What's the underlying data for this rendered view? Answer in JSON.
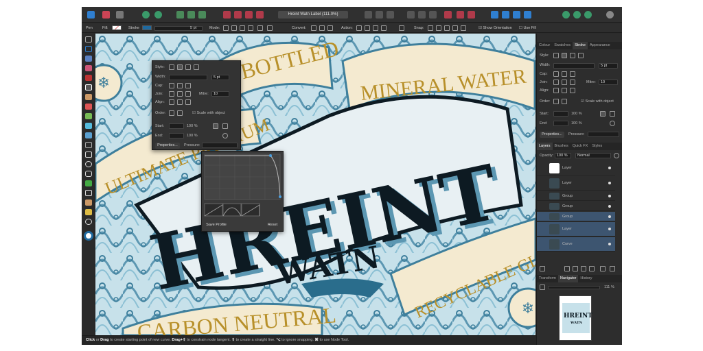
{
  "app": {
    "document_title": "Hreint Watn Label (111.0%)"
  },
  "context_toolbar": {
    "tool_name": "Pen",
    "fill_label": "Fill:",
    "stroke_label": "Stroke",
    "stroke_width": "5 pt",
    "mode_label": "Mode:",
    "convert_label": "Convert:",
    "action_label": "Action:",
    "snap_label": "Snap:",
    "show_orientation_label": "Show Orientation",
    "use_fill_label": "Use Fill",
    "stroke_color": "#1f6aa0"
  },
  "stroke_popover": {
    "style_label": "Style:",
    "width_label": "Width:",
    "width_value": "5 pt",
    "cap_label": "Cap:",
    "join_label": "Join:",
    "mitre_label": "Mitre:",
    "mitre_value": "10",
    "align_label": "Align:",
    "order_label": "Order:",
    "scale_label": "Scale with object",
    "start_label": "Start:",
    "end_label": "End:",
    "start_pct": "100 %",
    "end_pct": "100 %",
    "properties_label": "Properties...",
    "pressure_label": "Pressure:"
  },
  "pressure_curve": {
    "save_profile_label": "Save Profile",
    "reset_label": "Reset"
  },
  "right_panel": {
    "top_tabs": [
      "Colour",
      "Swatches",
      "Stroke",
      "Appearance"
    ],
    "active_top_tab": "Stroke",
    "style_label": "Style:",
    "width_label": "Width:",
    "width_value": "5 pt",
    "cap_label": "Cap:",
    "join_label": "Join:",
    "mitre_label": "Mitre:",
    "mitre_value": "10",
    "align_label": "Align:",
    "order_label": "Order:",
    "scale_label": "Scale with object",
    "start_label": "Start:",
    "end_label": "End:",
    "start_pct": "100 %",
    "end_pct": "100 %",
    "properties_label": "Properties...",
    "pressure_label": "Pressure:",
    "layer_tabs": [
      "Layers",
      "Brushes",
      "Quick FX",
      "Styles"
    ],
    "active_layer_tab": "Layers",
    "opacity_label": "Opacity:",
    "opacity_value": "100 %",
    "blend_mode": "Normal",
    "layers": [
      {
        "name": "Layer",
        "selected": false
      },
      {
        "name": "Layer",
        "selected": false
      },
      {
        "name": "Group",
        "selected": false
      },
      {
        "name": "Group",
        "selected": false
      },
      {
        "name": "Group",
        "selected": true
      },
      {
        "name": "Layer",
        "selected": true
      },
      {
        "name": "Curve",
        "selected": true
      }
    ],
    "nav_tabs": [
      "Transform",
      "Navigator",
      "History"
    ],
    "active_nav_tab": "Navigator",
    "zoom_value": "111 %"
  },
  "artwork": {
    "brand": "HREINT",
    "sub": "WATN",
    "banner_top_left": "BOTTLED",
    "banner_top_right": "MINERAL WATER",
    "banner_left": "ULTIMATE PREMIUM",
    "banner_right": "RECYCLABLE GLASS",
    "banner_bottom_left": "CARBON NEUTRAL",
    "nav_brand": "HREINT",
    "nav_sub": "WATN",
    "ink_color": "#0d1a22",
    "gold_color": "#b8902a",
    "blue_color": "#7fb2c9"
  },
  "status_bar": {
    "segments": [
      {
        "bold": "Click",
        "text": " or "
      },
      {
        "bold": "Drag",
        "text": " to create starting point of new curve. "
      },
      {
        "bold": "Drag+⇧",
        "text": " to constrain node tangent. "
      },
      {
        "bold": "⇧",
        "text": " to create a straight line. "
      },
      {
        "bold": "⌥",
        "text": " to ignore snapping. "
      },
      {
        "bold": "⌘",
        "text": " to use Node Tool."
      }
    ]
  }
}
